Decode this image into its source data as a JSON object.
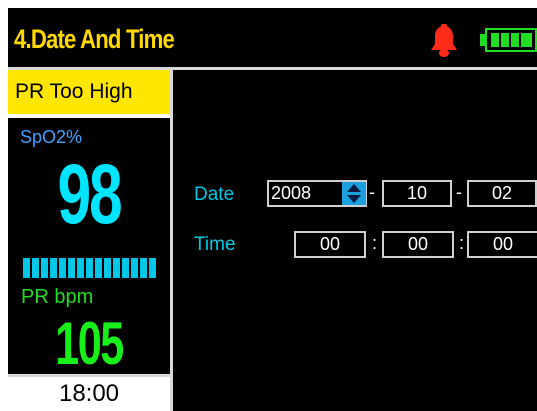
{
  "header": {
    "title": "4.Date And Time",
    "alarm_icon": "bell-icon",
    "battery_icon": "battery-full-icon",
    "colors": {
      "title": "#ffd800",
      "alarm": "#ff2b1a",
      "battery": "#22dd22"
    }
  },
  "left_panel": {
    "alarm_message": "PR Too High",
    "spo2": {
      "label": "SpO2%",
      "value": "98",
      "color": "#00e5ff"
    },
    "pulse_bar_level": 1.0,
    "pr": {
      "label": "PR bpm",
      "value": "105",
      "color": "#18ee18"
    },
    "clock": "18:00"
  },
  "main": {
    "date": {
      "label": "Date",
      "year": "2008",
      "sep1": "-",
      "month": "10",
      "sep2": "-",
      "day": "02"
    },
    "time": {
      "label": "Time",
      "hour": "00",
      "sep1": ":",
      "minute": "00",
      "sep2": ":",
      "second": "00"
    }
  }
}
